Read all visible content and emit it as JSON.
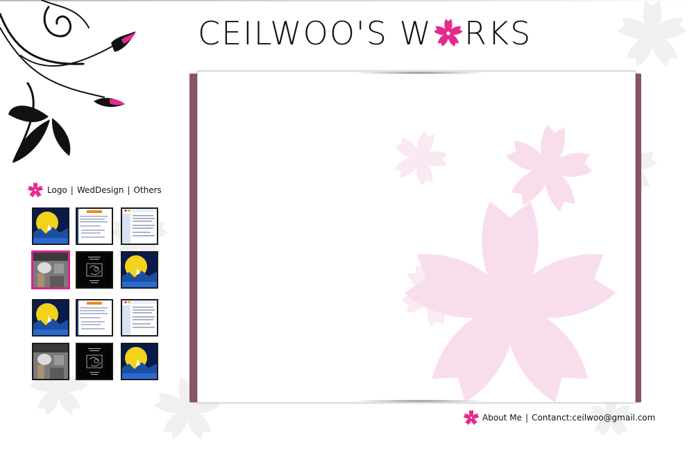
{
  "header": {
    "title_before": "CEILWOO'S W",
    "title_icon": "sakura-flower-icon",
    "title_after": "RKS"
  },
  "nav": {
    "icon": "sakura-flower-icon",
    "items": [
      {
        "label": "Logo"
      },
      {
        "label": "WedDesign"
      },
      {
        "label": "Others"
      }
    ],
    "separator": "|"
  },
  "thumbnails": {
    "rows": [
      [
        {
          "kind": "dark-night-scene"
        },
        {
          "kind": "document-page"
        },
        {
          "kind": "web-page-layout"
        }
      ],
      [
        {
          "kind": "gray-photo",
          "selected": true
        },
        {
          "kind": "black-sketch"
        },
        {
          "kind": "dark-night-scene"
        }
      ],
      [
        {
          "kind": "dark-night-scene"
        },
        {
          "kind": "document-page"
        },
        {
          "kind": "web-page-layout"
        }
      ],
      [
        {
          "kind": "gray-photo"
        },
        {
          "kind": "black-sketch"
        },
        {
          "kind": "dark-night-scene"
        }
      ]
    ]
  },
  "footer": {
    "icon": "sakura-flower-icon",
    "about_label": "About Me",
    "separator": "|",
    "contact_label": "Contanct:ceilwoo@gmail.com"
  },
  "colors": {
    "accent_pink": "#e6298f",
    "frame_mauve": "#8a5563",
    "blossom_light_pink": "#f6d3e6"
  }
}
